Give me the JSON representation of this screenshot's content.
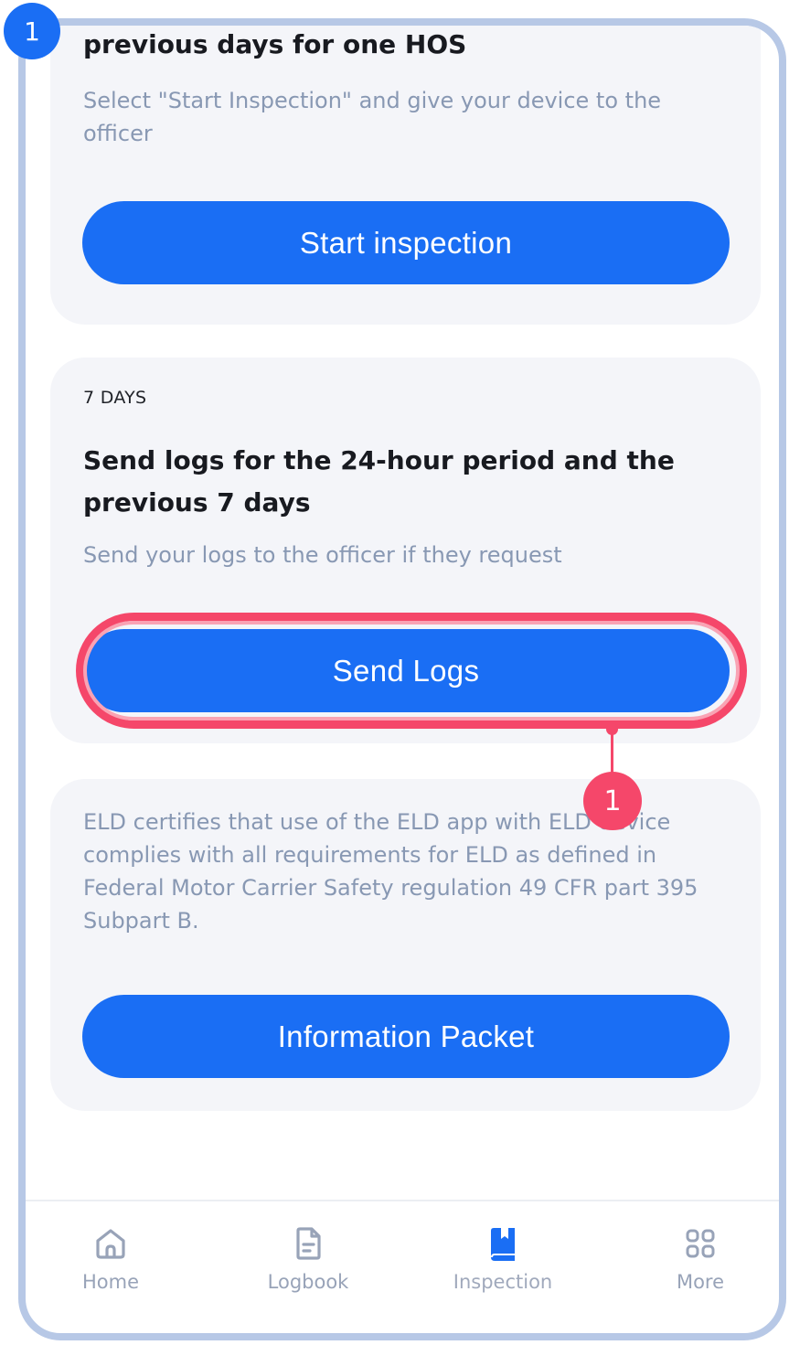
{
  "step_markers": {
    "top_left": "1",
    "callout": "1"
  },
  "inspection_card": {
    "title_partial": "previous days for one HOS",
    "subtitle": "Select \"Start Inspection\" and give your device to the officer",
    "button_label": "Start inspection"
  },
  "send_logs_card": {
    "kicker": "7 DAYS",
    "title": "Send logs for the 24-hour period and the previous 7 days",
    "subtitle": "Send your logs to the officer if they request",
    "button_label": "Send Logs"
  },
  "info_card": {
    "text": "ELD certifies that use of the ELD app with ELD device complies with all requirements for ELD as defined in Federal Motor Carrier Safety regulation 49 CFR part 395 Subpart B.",
    "button_label": "Information Packet"
  },
  "bottom_nav": {
    "items": [
      {
        "label": "Home",
        "icon": "home-icon",
        "active": false
      },
      {
        "label": "Logbook",
        "icon": "document-icon",
        "active": false
      },
      {
        "label": "Inspection",
        "icon": "book-icon",
        "active": true
      },
      {
        "label": "More",
        "icon": "grid-icon",
        "active": false
      }
    ]
  },
  "colors": {
    "primary": "#1a6ef4",
    "highlight": "#f5476a",
    "card_bg": "#f4f5f9",
    "muted_text": "#8898b3",
    "frame": "#b7c8e6"
  }
}
